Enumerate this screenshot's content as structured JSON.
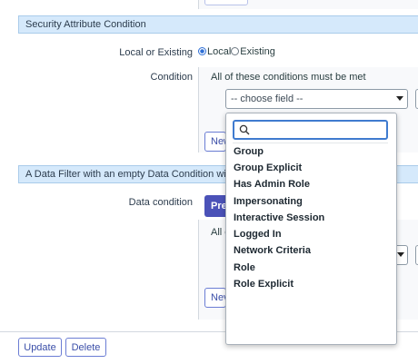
{
  "section1": {
    "title": "Security Attribute Condition"
  },
  "local_or_existing": {
    "label": "Local or Existing",
    "options": [
      {
        "label": "Local",
        "checked": true
      },
      {
        "label": "Existing",
        "checked": false
      }
    ]
  },
  "condition": {
    "label": "Condition",
    "hint": "All of these conditions must be met",
    "field_select_value": "-- choose field --",
    "new_button_label": "New"
  },
  "section2": {
    "title": "A Data Filter with an empty Data Condition will app"
  },
  "data_condition": {
    "label": "Data condition",
    "primary_button_label": "Pre",
    "hint_fragment": "All c",
    "new_button_label": "Nev"
  },
  "dropdown": {
    "search_placeholder": "",
    "items": [
      "Group",
      "Group Explicit",
      "Has Admin Role",
      "Impersonating",
      "Interactive Session",
      "Logged In",
      "Network Criteria",
      "Role",
      "Role Explicit"
    ]
  },
  "footer": {
    "update_label": "Update",
    "delete_label": "Delete"
  },
  "colors": {
    "accent": "#4b52b8",
    "section_bg": "#d5e9fb",
    "focus": "#3f7bcf"
  }
}
